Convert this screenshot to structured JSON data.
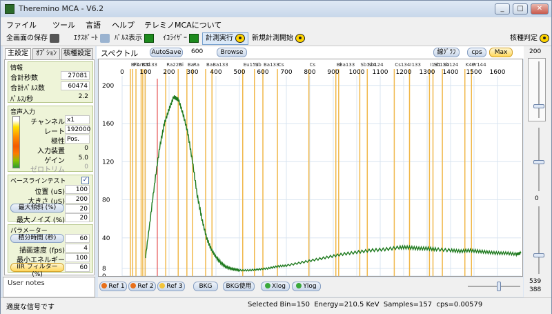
{
  "window": {
    "title": "Theremino MCA - V6.2",
    "minimize": "_",
    "maximize": "□",
    "close": "✕"
  },
  "menu": [
    "ファイル",
    "ツール",
    "言語",
    "ヘルプ",
    "テレミノMCAについて"
  ],
  "toolbar": {
    "save": "全画面の保存",
    "export": "ｴｸｽﾎﾟｰﾄ",
    "pulse": "ﾊﾟﾙｽ表示",
    "equalizer": "ｲｺﾗｲｻﾞｰ",
    "run": "計測実行",
    "new_run": "新規計測開始",
    "nuclide": "核種判定"
  },
  "tabs": [
    "主設定",
    "ｵﾌﾟｼｮﾝ",
    "核種設定"
  ],
  "info": {
    "title": "情報",
    "rows": [
      {
        "label": "合計秒数",
        "value": "27081"
      },
      {
        "label": "合計ﾊﾟﾙｽ数",
        "value": "60474"
      },
      {
        "label": "ﾊﾟﾙｽ/秒",
        "value": "2.2"
      }
    ]
  },
  "audio": {
    "title": "音声入力",
    "rows": [
      {
        "label": "チャンネル",
        "value": "x1"
      },
      {
        "label": "レート",
        "value": "192000"
      },
      {
        "label": "極性",
        "value": "Pos."
      },
      {
        "label": "入力装置",
        "value": "0"
      },
      {
        "label": "ゲイン",
        "value": "5.0"
      },
      {
        "label": "ゼロトリム",
        "value": "0"
      }
    ]
  },
  "baseline": {
    "title": "ベースラインテスト",
    "checked": "✓",
    "rows": [
      {
        "label": "位置 (uS)",
        "value": "100"
      },
      {
        "label": "大きさ (uS)",
        "value": "200"
      },
      {
        "label": "最大傾斜 (%)",
        "value": "20"
      },
      {
        "label": "最大ノイズ (%)",
        "value": "20"
      }
    ]
  },
  "params": {
    "title": "パラメーター",
    "rows": [
      {
        "label": "積分時間 (秒)",
        "value": "60"
      },
      {
        "label": "描画速度 (fps)",
        "value": "4"
      },
      {
        "label": "最小エネルギー",
        "value": "100"
      },
      {
        "label": "IIR フィルター (%)",
        "value": "60"
      }
    ]
  },
  "user_notes": "User notes",
  "graph": {
    "title": "スペクトル",
    "autosave": "AutoSave",
    "autosave_value": "600",
    "browse": "Browse",
    "line_graph": "線ｸﾞﾗﾌ",
    "cps": "cps",
    "max": "Max",
    "max_value": "200"
  },
  "right_panel": {
    "zero": "0",
    "v1": "539",
    "v2": "388"
  },
  "bottom": {
    "ref1": "Ref 1",
    "ref2": "Ref 2",
    "ref3": "Ref 3",
    "bkg": "BKG",
    "bkg_use": "BKG使用",
    "xlog": "Xlog",
    "ylog": "Ylog"
  },
  "status": {
    "message": "適度な信号です",
    "info": "Selected Bin=150  Energy=210.5 KeV  Samples=157  cps=0.00579"
  },
  "colors": {
    "spectrum": "#1e7a1e",
    "nuclide_line": "#f0b84a",
    "marker": "#e03030",
    "grid": "#d8e4f0"
  },
  "chart_data": {
    "type": "line",
    "xlim": [
      0,
      1700
    ],
    "ylim": [
      0,
      210
    ],
    "x_ticks": [
      0,
      100,
      200,
      300,
      400,
      500,
      600,
      700,
      800,
      900,
      1000,
      1100,
      1200,
      1300,
      1400,
      1500,
      1600
    ],
    "y_ticks": [
      0,
      8,
      40,
      80,
      120,
      160,
      200
    ],
    "selected_bin": 150,
    "nuclide_labels": [
      {
        "label": "Bi",
        "x": 35
      },
      {
        "label": "Pb",
        "x": 45
      },
      {
        "label": "Am",
        "x": 59
      },
      {
        "label": "Ba133",
        "x": 81
      },
      {
        "label": "Cs",
        "x": 88
      },
      {
        "label": "Tl",
        "x": 98
      },
      {
        "label": "Ra226",
        "x": 186
      },
      {
        "label": "Bi",
        "x": 239
      },
      {
        "label": "Ba",
        "x": 276
      },
      {
        "label": "Ra",
        "x": 300
      },
      {
        "label": "Ba",
        "x": 356
      },
      {
        "label": "Ba133",
        "x": 383
      },
      {
        "label": "Eu152",
        "x": 514
      },
      {
        "label": "Sb",
        "x": 564
      },
      {
        "label": "Ba133",
        "x": 600
      },
      {
        "label": "Cs",
        "x": 662
      },
      {
        "label": "Cs",
        "x": 796
      },
      {
        "label": "Bi",
        "x": 911
      },
      {
        "label": "Ba133",
        "x": 923
      },
      {
        "label": "Sb124",
        "x": 1013
      },
      {
        "label": "Sb124",
        "x": 1045
      },
      {
        "label": "Cs134",
        "x": 1160
      },
      {
        "label": "I133",
        "x": 1225
      },
      {
        "label": "I131",
        "x": 1310
      },
      {
        "label": "Sb124",
        "x": 1325
      },
      {
        "label": "Sb124",
        "x": 1365
      },
      {
        "label": "K40",
        "x": 1461
      },
      {
        "label": "Pr144",
        "x": 1489
      }
    ],
    "series": [
      {
        "x": [
          100,
          120,
          140,
          160,
          180,
          200,
          220,
          240,
          260,
          280,
          300,
          320,
          340,
          360,
          380,
          400,
          420,
          440,
          460,
          480,
          500,
          540,
          580,
          620,
          660,
          700,
          760,
          820,
          880,
          940,
          1000,
          1060,
          1120,
          1180,
          1220,
          1260,
          1300,
          1340,
          1400,
          1440,
          1480,
          1520,
          1560,
          1600,
          1640,
          1680,
          1700
        ],
        "values": [
          20,
          60,
          100,
          135,
          160,
          175,
          188,
          185,
          170,
          150,
          120,
          85,
          60,
          40,
          28,
          20,
          14,
          10,
          8,
          7,
          6,
          6,
          7,
          8,
          10,
          11,
          14,
          17,
          20,
          23,
          25,
          27,
          28,
          30,
          30,
          29,
          29,
          28,
          27,
          26,
          27,
          26,
          25,
          24,
          24,
          23,
          24
        ]
      }
    ]
  }
}
